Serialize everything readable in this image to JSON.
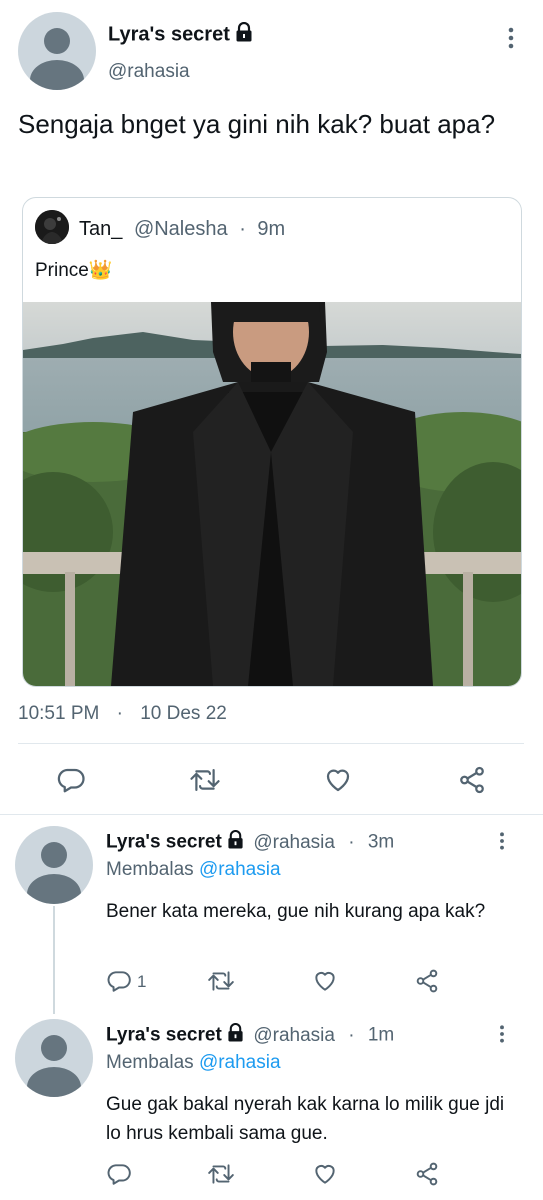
{
  "main_tweet": {
    "display_name": "Lyra's secret",
    "handle": "@rahasia",
    "text": "Sengaja bnget ya gini nih kak? buat apa?",
    "time": "10:51 PM",
    "date": "10 Des 22",
    "quoted": {
      "display_name": "Tan_",
      "handle": "@Nalesha",
      "time_ago": "9m",
      "text": "Prince👑"
    }
  },
  "replies": [
    {
      "display_name": "Lyra's secret",
      "handle": "@rahasia",
      "time_ago": "3m",
      "replying_label": "Membalas",
      "replying_handle": "@rahasia",
      "text": "Bener kata mereka, gue nih kurang apa kak?",
      "reply_count": "1"
    },
    {
      "display_name": "Lyra's secret",
      "handle": "@rahasia",
      "time_ago": "1m",
      "replying_label": "Membalas",
      "replying_handle": "@rahasia",
      "text": "Gue gak bakal nyerah kak karna lo milik gue jdi lo hrus kembali sama gue.",
      "reply_count": ""
    }
  ],
  "separator_dot": "·",
  "icons": {
    "more": "more-vertical-icon",
    "lock": "lock-icon",
    "reply": "reply-icon",
    "retweet": "retweet-icon",
    "like": "heart-icon",
    "share": "share-icon"
  },
  "colors": {
    "text": "#0f1419",
    "secondary": "#536471",
    "link": "#1d9bf0",
    "divider": "#e1e8ed",
    "avatar_bg": "#ccd6dd",
    "avatar_fg": "#66757f"
  }
}
